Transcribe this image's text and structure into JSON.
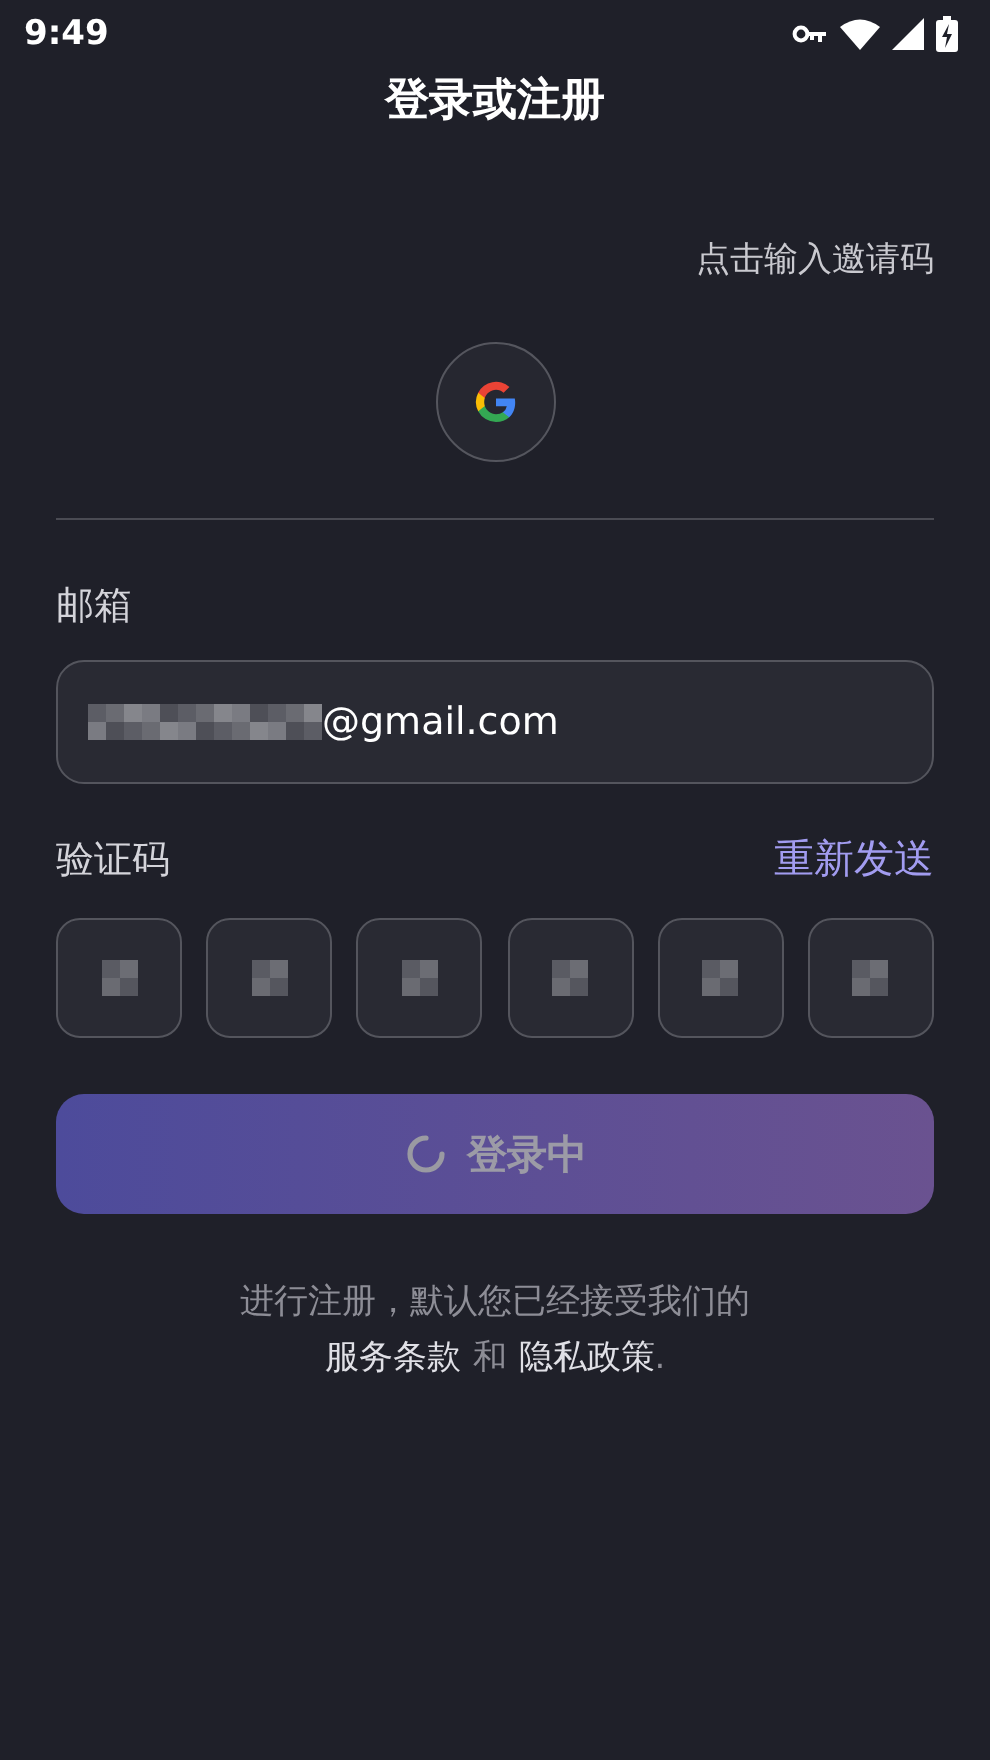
{
  "status_bar": {
    "time": "9:49",
    "charging": true
  },
  "title": "登录或注册",
  "invite_link": "点击输入邀请码",
  "email": {
    "label": "邮箱",
    "value": "@gmail.com",
    "masked_prefix": true
  },
  "code": {
    "label": "验证码",
    "resend": "重新发送",
    "boxes": [
      {
        "masked": true
      },
      {
        "masked": true
      },
      {
        "masked": true
      },
      {
        "masked": true
      },
      {
        "masked": true
      },
      {
        "masked": true
      }
    ]
  },
  "login_button": {
    "label": "登录中",
    "loading": true
  },
  "terms": {
    "line1": "进行注册，默认您已经接受我们的",
    "terms_link": "服务条款",
    "conjunction": "和",
    "privacy_link": "隐私政策",
    "end": "."
  }
}
